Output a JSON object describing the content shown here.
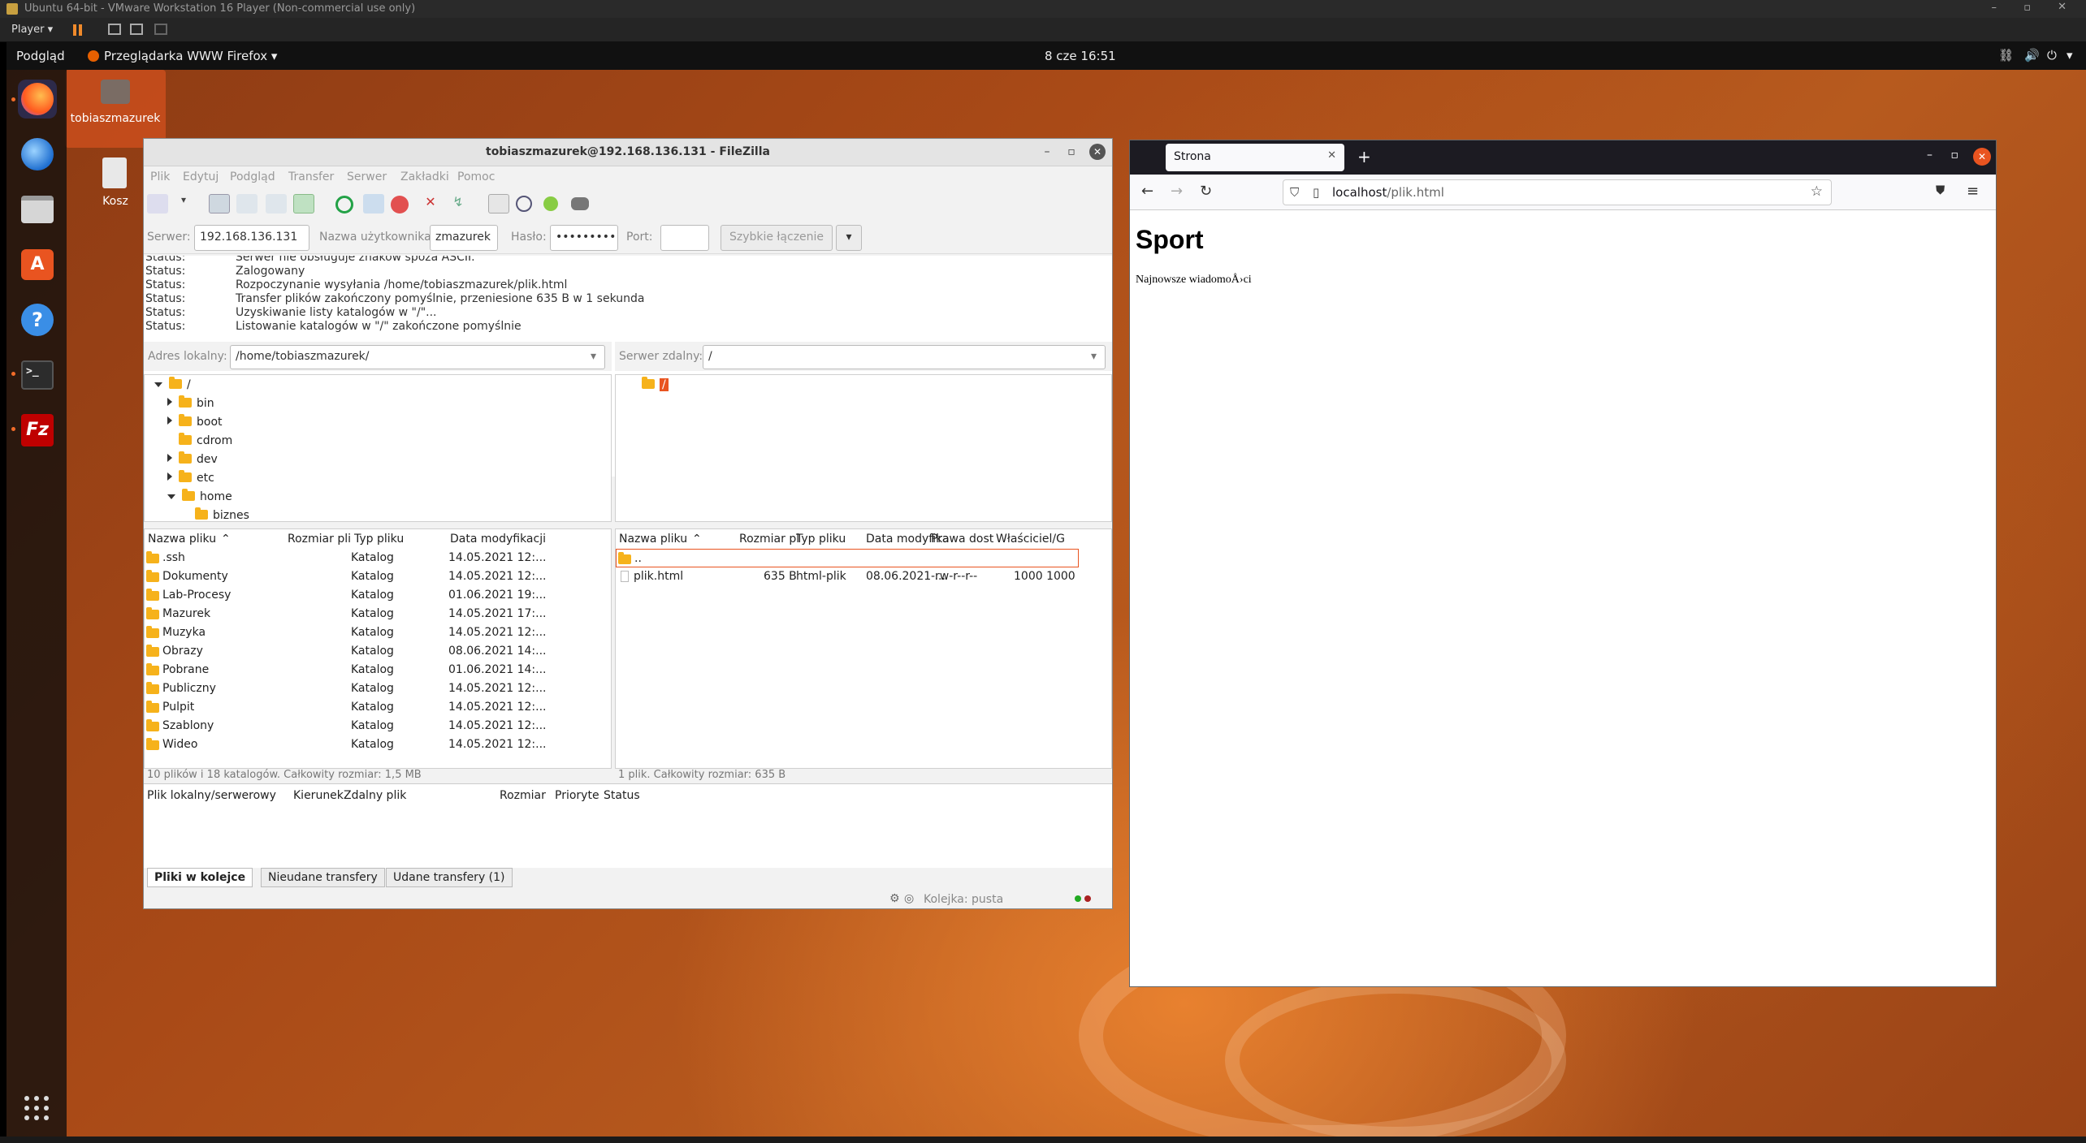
{
  "vmware": {
    "title": "Ubuntu 64-bit - VMware Workstation 16 Player (Non-commercial use only)",
    "player_label": "Player"
  },
  "topbar": {
    "activities": "Podgląd",
    "app_menu": "Przeglądarka WWW Firefox",
    "clock": "8 cze  16:51"
  },
  "desktop": {
    "icons": [
      {
        "label": "tobiaszmazurek"
      },
      {
        "label": "Kosz"
      }
    ]
  },
  "dock": {
    "items": [
      "firefox-icon",
      "thunderbird-icon",
      "files-icon",
      "software-icon",
      "help-icon",
      "terminal-icon",
      "filezilla-icon"
    ],
    "filezilla_glyph": "Fz",
    "help_glyph": "?",
    "terminal_glyph": ">_"
  },
  "filezilla": {
    "title": "tobiaszmazurek@192.168.136.131 - FileZilla",
    "menu": [
      "Plik",
      "Edytuj",
      "Podgląd",
      "Transfer",
      "Serwer",
      "Zakładki",
      "Pomoc"
    ],
    "quickconnect": {
      "server_label": "Serwer:",
      "server_value": "192.168.136.131",
      "user_label": "Nazwa użytkownika:",
      "user_value": "zmazurek",
      "password_label": "Hasło:",
      "password_value": "••••••••••",
      "port_label": "Port:",
      "port_value": "",
      "connect_button": "Szybkie łączenie"
    },
    "log": [
      {
        "status": "Status:",
        "message": "Serwer nie obsługuje znaków spoza ASCII."
      },
      {
        "status": "Status:",
        "message": "Zalogowany"
      },
      {
        "status": "Status:",
        "message": "Rozpoczynanie wysyłania /home/tobiaszmazurek/plik.html"
      },
      {
        "status": "Status:",
        "message": "Transfer plików zakończony pomyślnie, przeniesione 635 B w 1 sekunda"
      },
      {
        "status": "Status:",
        "message": "Uzyskiwanie listy katalogów w \"/\"..."
      },
      {
        "status": "Status:",
        "message": "Listowanie katalogów w \"/\" zakończone pomyślnie"
      }
    ],
    "local": {
      "address_label": "Adres lokalny:",
      "address_value": "/home/tobiaszmazurek/",
      "tree": [
        {
          "name": "/",
          "expander": "down",
          "indent": 0
        },
        {
          "name": "bin",
          "expander": "right",
          "indent": 1
        },
        {
          "name": "boot",
          "expander": "right",
          "indent": 1
        },
        {
          "name": "cdrom",
          "expander": "none",
          "indent": 1
        },
        {
          "name": "dev",
          "expander": "right",
          "indent": 1
        },
        {
          "name": "etc",
          "expander": "right",
          "indent": 1
        },
        {
          "name": "home",
          "expander": "down",
          "indent": 1
        },
        {
          "name": "biznes",
          "expander": "none",
          "indent": 2
        }
      ],
      "columns": [
        "Nazwa pliku",
        "Rozmiar pli",
        "Typ pliku",
        "Data modyfikacji"
      ],
      "files": [
        {
          "name": ".ssh",
          "size": "",
          "type": "Katalog",
          "modified": "14.05.2021 12:..."
        },
        {
          "name": "Dokumenty",
          "size": "",
          "type": "Katalog",
          "modified": "14.05.2021 12:..."
        },
        {
          "name": "Lab-Procesy",
          "size": "",
          "type": "Katalog",
          "modified": "01.06.2021 19:..."
        },
        {
          "name": "Mazurek",
          "size": "",
          "type": "Katalog",
          "modified": "14.05.2021 17:..."
        },
        {
          "name": "Muzyka",
          "size": "",
          "type": "Katalog",
          "modified": "14.05.2021 12:..."
        },
        {
          "name": "Obrazy",
          "size": "",
          "type": "Katalog",
          "modified": "08.06.2021 14:..."
        },
        {
          "name": "Pobrane",
          "size": "",
          "type": "Katalog",
          "modified": "01.06.2021 14:..."
        },
        {
          "name": "Publiczny",
          "size": "",
          "type": "Katalog",
          "modified": "14.05.2021 12:..."
        },
        {
          "name": "Pulpit",
          "size": "",
          "type": "Katalog",
          "modified": "14.05.2021 12:..."
        },
        {
          "name": "Szablony",
          "size": "",
          "type": "Katalog",
          "modified": "14.05.2021 12:..."
        },
        {
          "name": "Wideo",
          "size": "",
          "type": "Katalog",
          "modified": "14.05.2021 12:..."
        }
      ],
      "summary": "10 plików i 18 katalogów. Całkowity rozmiar: 1,5 MB"
    },
    "remote": {
      "address_label": "Serwer zdalny:",
      "address_value": "/",
      "tree_root": "/",
      "columns": [
        "Nazwa pliku",
        "Rozmiar pl",
        "Typ pliku",
        "Data modyfika",
        "Prawa dost",
        "Właściciel/G"
      ],
      "parent_dir": "..",
      "files": [
        {
          "name": "plik.html",
          "size": "635 B",
          "type": "html-plik",
          "modified": "08.06.2021 ...",
          "perms": "-rw-r--r--",
          "owner": "1000 1000"
        }
      ],
      "summary": "1 plik. Całkowity rozmiar: 635 B"
    },
    "queue": {
      "columns": [
        "Plik lokalny/serwerowy",
        "Kierunek",
        "Zdalny plik",
        "Rozmiar",
        "Prioryte",
        "Status"
      ],
      "tabs": [
        "Pliki w kolejce",
        "Nieudane transfery",
        "Udane transfery (1)"
      ],
      "status": "Kolejka: pusta"
    }
  },
  "firefox": {
    "tab_title": "Strona",
    "url_host": "localhost",
    "url_path": "/plik.html",
    "page": {
      "heading": "Sport",
      "paragraph": "Najnowsze wiadomoÅ›ci"
    }
  }
}
